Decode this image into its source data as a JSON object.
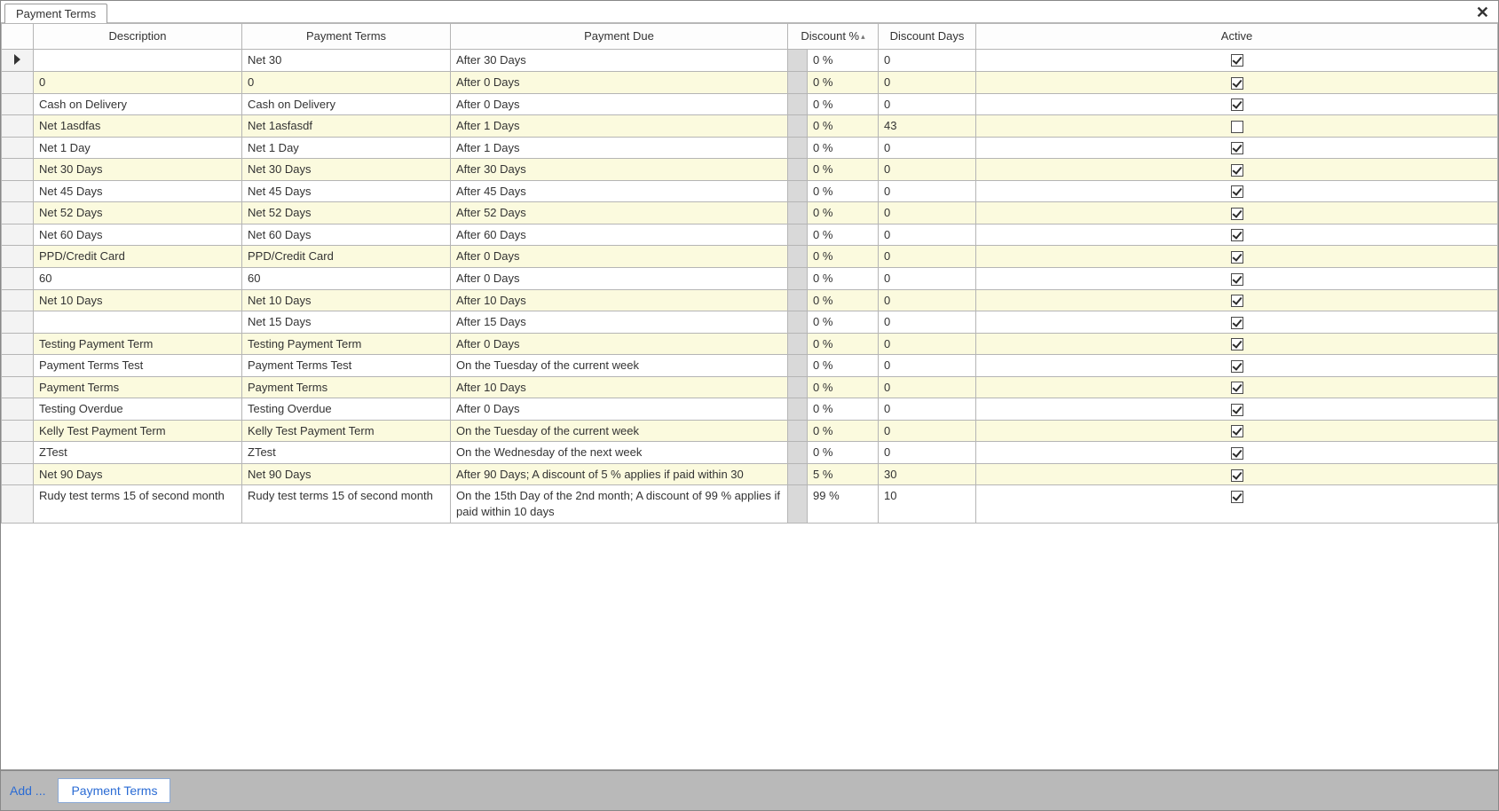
{
  "tab": {
    "label": "Payment Terms"
  },
  "closeGlyph": "✕",
  "columns": {
    "description": "Description",
    "paymentTerms": "Payment Terms",
    "paymentDue": "Payment Due",
    "discountPct": "Discount %",
    "discountDays": "Discount Days",
    "active": "Active"
  },
  "sortIndicator": "▴",
  "rows": [
    {
      "selected": true,
      "alt": false,
      "description": "",
      "terms": "Net 30",
      "due": "After 30 Days",
      "discPct": "0 %",
      "discDays": "0",
      "active": true
    },
    {
      "selected": false,
      "alt": true,
      "description": "0",
      "terms": "0",
      "due": "After 0 Days",
      "discPct": "0 %",
      "discDays": "0",
      "active": true
    },
    {
      "selected": false,
      "alt": false,
      "description": "Cash on Delivery",
      "terms": "Cash on Delivery",
      "due": "After 0 Days",
      "discPct": "0 %",
      "discDays": "0",
      "active": true
    },
    {
      "selected": false,
      "alt": true,
      "description": "Net 1asdfas",
      "terms": "Net 1asfasdf",
      "due": "After 1 Days",
      "discPct": "0 %",
      "discDays": "43",
      "active": false
    },
    {
      "selected": false,
      "alt": false,
      "description": "Net 1 Day",
      "terms": "Net 1 Day",
      "due": "After 1 Days",
      "discPct": "0 %",
      "discDays": "0",
      "active": true
    },
    {
      "selected": false,
      "alt": true,
      "description": "Net 30 Days",
      "terms": "Net 30 Days",
      "due": "After 30 Days",
      "discPct": "0 %",
      "discDays": "0",
      "active": true
    },
    {
      "selected": false,
      "alt": false,
      "description": "Net 45 Days",
      "terms": "Net 45 Days",
      "due": "After 45 Days",
      "discPct": "0 %",
      "discDays": "0",
      "active": true
    },
    {
      "selected": false,
      "alt": true,
      "description": "Net 52 Days",
      "terms": "Net 52 Days",
      "due": "After 52 Days",
      "discPct": "0 %",
      "discDays": "0",
      "active": true
    },
    {
      "selected": false,
      "alt": false,
      "description": "Net 60 Days",
      "terms": "Net 60 Days",
      "due": "After 60 Days",
      "discPct": "0 %",
      "discDays": "0",
      "active": true
    },
    {
      "selected": false,
      "alt": true,
      "description": "PPD/Credit Card",
      "terms": "PPD/Credit Card",
      "due": "After 0 Days",
      "discPct": "0 %",
      "discDays": "0",
      "active": true
    },
    {
      "selected": false,
      "alt": false,
      "description": "60",
      "terms": "60",
      "due": "After 0 Days",
      "discPct": "0 %",
      "discDays": "0",
      "active": true
    },
    {
      "selected": false,
      "alt": true,
      "description": "Net 10 Days",
      "terms": "Net 10 Days",
      "due": "After 10 Days",
      "discPct": "0 %",
      "discDays": "0",
      "active": true
    },
    {
      "selected": false,
      "alt": false,
      "description": "",
      "terms": "Net 15 Days",
      "due": "After 15 Days",
      "discPct": "0 %",
      "discDays": "0",
      "active": true
    },
    {
      "selected": false,
      "alt": true,
      "description": "Testing Payment Term",
      "terms": "Testing Payment Term",
      "due": "After 0 Days",
      "discPct": "0 %",
      "discDays": "0",
      "active": true
    },
    {
      "selected": false,
      "alt": false,
      "description": "Payment Terms Test",
      "terms": "Payment Terms Test",
      "due": "On the Tuesday of the current week",
      "discPct": "0 %",
      "discDays": "0",
      "active": true
    },
    {
      "selected": false,
      "alt": true,
      "description": "Payment Terms",
      "terms": "Payment Terms",
      "due": "After 10 Days",
      "discPct": "0 %",
      "discDays": "0",
      "active": true
    },
    {
      "selected": false,
      "alt": false,
      "description": "Testing Overdue",
      "terms": "Testing Overdue",
      "due": "After 0 Days",
      "discPct": "0 %",
      "discDays": "0",
      "active": true
    },
    {
      "selected": false,
      "alt": true,
      "description": "Kelly Test Payment Term",
      "terms": "Kelly Test Payment Term",
      "due": "On the Tuesday of the current week",
      "discPct": "0 %",
      "discDays": "0",
      "active": true
    },
    {
      "selected": false,
      "alt": false,
      "description": "ZTest",
      "terms": "ZTest",
      "due": "On the Wednesday of the next week",
      "discPct": "0 %",
      "discDays": "0",
      "active": true
    },
    {
      "selected": false,
      "alt": true,
      "description": "Net 90 Days",
      "terms": "Net 90 Days",
      "due": "After 90 Days; A discount of 5 % applies if paid within 30",
      "discPct": "5 %",
      "discDays": "30",
      "active": true
    },
    {
      "selected": false,
      "alt": false,
      "description": "Rudy test terms 15 of second month",
      "terms": "Rudy test terms 15 of second month",
      "due": "On the 15th Day of the 2nd month; A discount of 99 % applies if paid within 10 days",
      "discPct": "99 %",
      "discDays": "10",
      "active": true
    }
  ],
  "statusbar": {
    "addLabel": "Add ...",
    "paymentTermsBtn": "Payment Terms"
  }
}
